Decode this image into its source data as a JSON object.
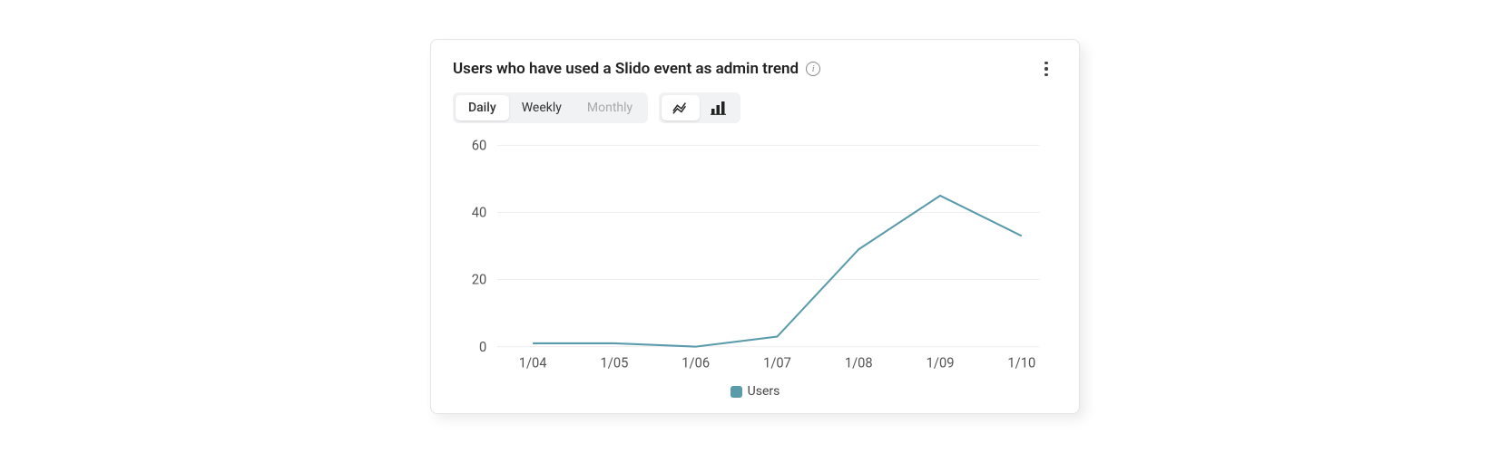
{
  "card": {
    "title": "Users who have used a Slido event as admin trend"
  },
  "timeTabs": {
    "daily": "Daily",
    "weekly": "Weekly",
    "monthly": "Monthly"
  },
  "legend": {
    "series1": "Users"
  },
  "xTicks": [
    "1/04",
    "1/05",
    "1/06",
    "1/07",
    "1/08",
    "1/09",
    "1/10"
  ],
  "yTicks": [
    "0",
    "20",
    "40",
    "60"
  ],
  "chart_data": {
    "type": "line",
    "title": "Users who have used a Slido event as admin trend",
    "xlabel": "",
    "ylabel": "",
    "ylim": [
      0,
      60
    ],
    "categories": [
      "1/04",
      "1/05",
      "1/06",
      "1/07",
      "1/08",
      "1/09",
      "1/10"
    ],
    "series": [
      {
        "name": "Users",
        "values": [
          1,
          1,
          0,
          3,
          29,
          45,
          33
        ]
      }
    ],
    "legend_position": "bottom",
    "grid": true
  }
}
